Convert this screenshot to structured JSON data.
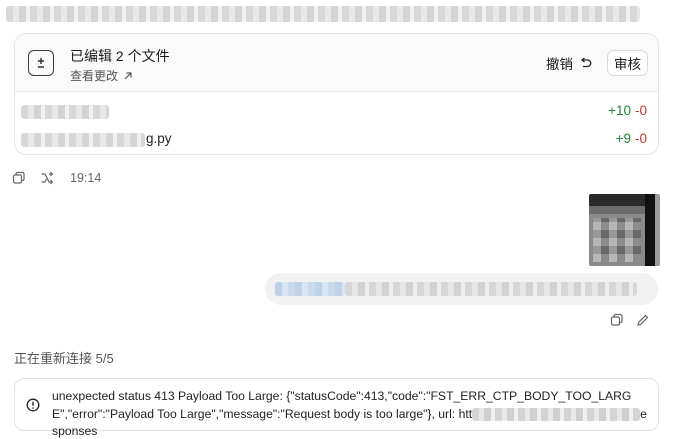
{
  "edited_card": {
    "title": "已编辑 2 个文件",
    "view_changes": "查看更改",
    "undo_label": "撤销",
    "review_label": "审核",
    "files": [
      {
        "name_suffix": "",
        "added": "+10",
        "removed": "-0"
      },
      {
        "name_suffix": "g.py",
        "added": "+9",
        "removed": "-0"
      }
    ]
  },
  "meta": {
    "time": "19:14"
  },
  "status": {
    "reconnecting": "正在重新连接 5/5"
  },
  "error": {
    "text_before": "unexpected status 413 Payload Too Large: {\"statusCode\":413,\"code\":\"FST_ERR_CTP_BODY_TOO_LARGE\",\"error\":\"Payload Too Large\",\"message\":\"Request body is too large\"}, url: htt",
    "text_after": "esponses"
  },
  "colors": {
    "added": "#22893a",
    "removed": "#c6352b",
    "bubble": "#f2f2f2"
  },
  "icons": [
    "diff-icon",
    "external-arrow-icon",
    "undo-icon",
    "copy-icon",
    "branch-icon",
    "edit-icon",
    "alert-circle-icon"
  ]
}
